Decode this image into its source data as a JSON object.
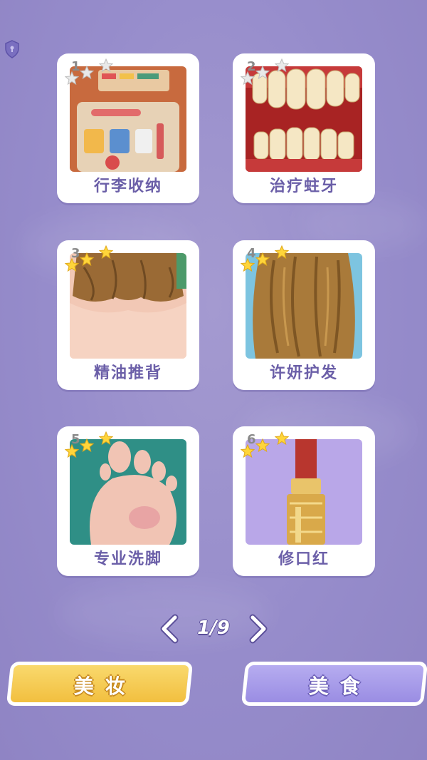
{
  "levels": [
    {
      "num": "1",
      "label": "行李收纳",
      "stars": 0
    },
    {
      "num": "2",
      "label": "治疗蛀牙",
      "stars": 0
    },
    {
      "num": "3",
      "label": "精油推背",
      "stars": 3
    },
    {
      "num": "4",
      "label": "许妍护发",
      "stars": 3
    },
    {
      "num": "5",
      "label": "专业洗脚",
      "stars": 3
    },
    {
      "num": "6",
      "label": "修口红",
      "stars": 3
    }
  ],
  "pager": {
    "page": "1/9"
  },
  "buttons": {
    "makeup": "美妆",
    "food": "美食"
  },
  "colors": {
    "background": "#968ccb",
    "label": "#6b5fa8",
    "star_on": "#ffd53a",
    "star_off": "#e6e6e6",
    "makeup_button": "#f2bf3f",
    "food_button": "#9a8de3"
  }
}
